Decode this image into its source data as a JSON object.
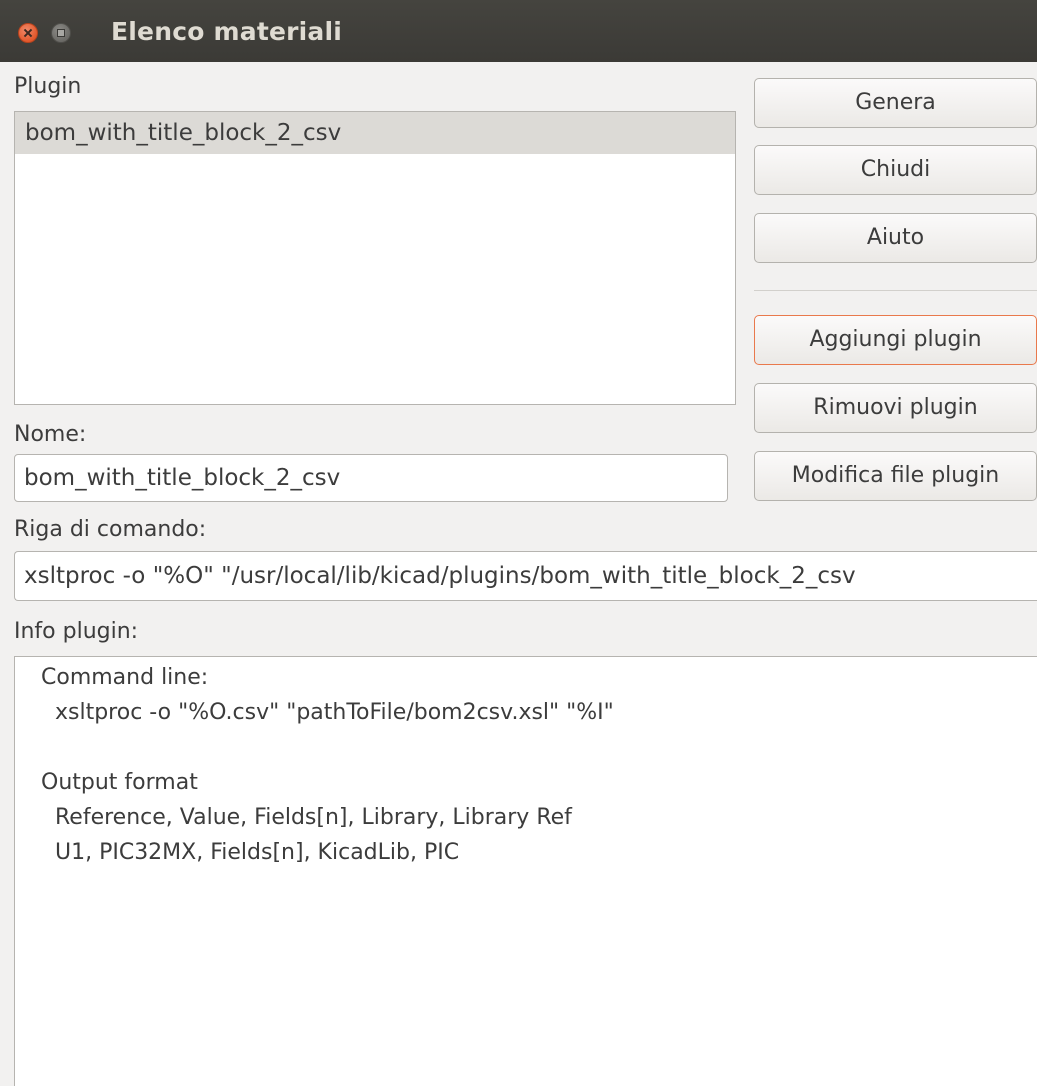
{
  "window": {
    "title": "Elenco materiali",
    "close_icon": "close-icon",
    "maximize_icon": "maximize-icon"
  },
  "plugin_list": {
    "label": "Plugin",
    "items": [
      "bom_with_title_block_2_csv"
    ],
    "selected_index": 0
  },
  "name_field": {
    "label": "Nome:",
    "value": "bom_with_title_block_2_csv"
  },
  "command_field": {
    "label": "Riga di comando:",
    "value": "xsltproc -o \"%O\" \"/usr/local/lib/kicad/plugins/bom_with_title_block_2_csv"
  },
  "info": {
    "label": "Info plugin:",
    "lines": [
      "Command line:",
      "  xsltproc -o \"%O.csv\" \"pathToFile/bom2csv.xsl\" \"%I\"",
      "",
      "Output format",
      "  Reference, Value, Fields[n], Library, Library Ref",
      "  U1, PIC32MX, Fields[n], KicadLib, PIC"
    ]
  },
  "buttons": {
    "generate": "Genera",
    "close": "Chiudi",
    "help": "Aiuto",
    "add_plugin": "Aggiungi plugin",
    "remove_plugin": "Rimuovi plugin",
    "edit_plugin_file": "Modifica file plugin"
  },
  "colors": {
    "titlebar": "#3c3b37",
    "close_button": "#e2582c",
    "focus_border": "#e9794c",
    "selected_row": "#dcdad6"
  }
}
